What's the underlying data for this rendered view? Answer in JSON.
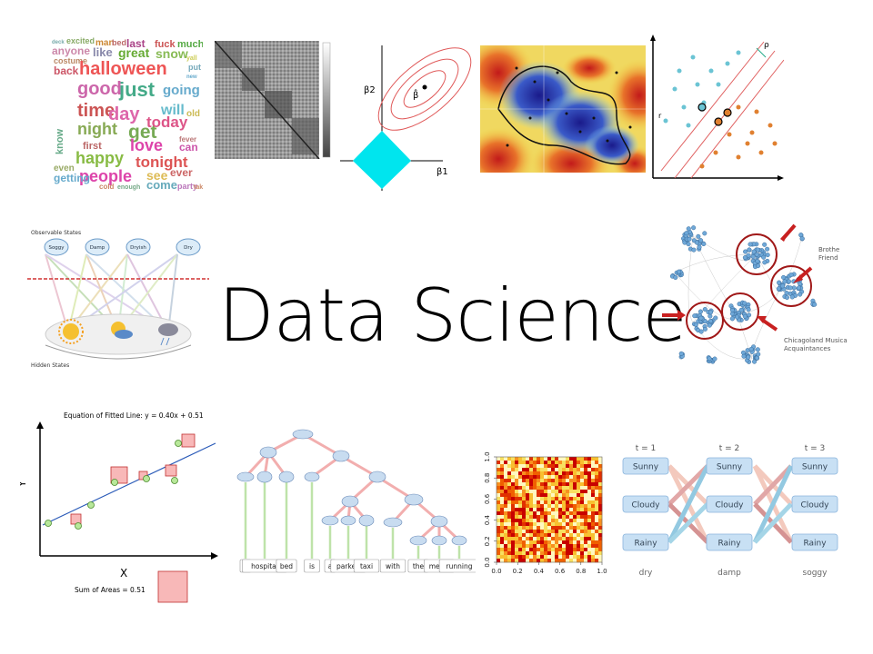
{
  "title": "Data Science",
  "wordcloud": {
    "words": [
      {
        "t": "deck",
        "c": "#7aa"
      },
      {
        "t": "excited",
        "c": "#8a6"
      },
      {
        "t": "man",
        "c": "#c83"
      },
      {
        "t": "bed",
        "c": "#b66"
      },
      {
        "t": "last",
        "c": "#a48"
      },
      {
        "t": "fuck",
        "c": "#c55"
      },
      {
        "t": "much",
        "c": "#5a4"
      },
      {
        "t": "anyone",
        "c": "#c8a"
      },
      {
        "t": "like",
        "c": "#88a"
      },
      {
        "t": "great",
        "c": "#6a3"
      },
      {
        "t": "snow",
        "c": "#8b5"
      },
      {
        "t": "yall",
        "c": "#cc5"
      },
      {
        "t": "costume",
        "c": "#b86"
      },
      {
        "t": "halloween",
        "c": "#e55"
      },
      {
        "t": "put",
        "c": "#7ab"
      },
      {
        "t": "back",
        "c": "#c56"
      },
      {
        "t": "new",
        "c": "#6ac"
      },
      {
        "t": "good",
        "c": "#c6a"
      },
      {
        "t": "just",
        "c": "#4a8"
      },
      {
        "t": "going",
        "c": "#6ac"
      },
      {
        "t": "time",
        "c": "#c55"
      },
      {
        "t": "day",
        "c": "#d6a"
      },
      {
        "t": "will",
        "c": "#6bc"
      },
      {
        "t": "old",
        "c": "#cb5"
      },
      {
        "t": "night",
        "c": "#8a5"
      },
      {
        "t": "get",
        "c": "#7a5"
      },
      {
        "t": "today",
        "c": "#d58"
      },
      {
        "t": "know",
        "c": "#6a8"
      },
      {
        "t": "first",
        "c": "#b66"
      },
      {
        "t": "love",
        "c": "#d4a"
      },
      {
        "t": "can",
        "c": "#c5a"
      },
      {
        "t": "fever",
        "c": "#b77"
      },
      {
        "t": "happy",
        "c": "#8b4"
      },
      {
        "t": "tonight",
        "c": "#d55"
      },
      {
        "t": "even",
        "c": "#9a6"
      },
      {
        "t": "people",
        "c": "#d4a"
      },
      {
        "t": "see",
        "c": "#db5"
      },
      {
        "t": "ever",
        "c": "#c66"
      },
      {
        "t": "getting",
        "c": "#6ac"
      },
      {
        "t": "come",
        "c": "#6ab"
      },
      {
        "t": "party",
        "c": "#b7b"
      },
      {
        "t": "cold",
        "c": "#c86"
      },
      {
        "t": "enough",
        "c": "#7a8"
      },
      {
        "t": "take",
        "c": "#c86"
      }
    ]
  },
  "lasso": {
    "beta1": "β1",
    "beta2": "β2",
    "betahat": "β̂"
  },
  "svm": {
    "rho": "ρ",
    "r": "r"
  },
  "hmm_top": {
    "observable_label": "Observable States",
    "hidden_label": "Hidden States",
    "states": [
      "Soggy",
      "Damp",
      "Dryish",
      "Dry"
    ]
  },
  "network": {
    "label1a": "Brothe",
    "label1b": "Friend",
    "label2a": "Chicagoland Musica",
    "label2b": "Acquaintances"
  },
  "regression": {
    "equation": "Equation of Fitted Line: y = 0.40x + 0.51",
    "xlabel": "X",
    "ylabel": "Y",
    "sum": "Sum of Areas = 0.51"
  },
  "parse_tree": {
    "words": [
      "a",
      "hospital",
      "bed",
      "is",
      "a",
      "parked",
      "taxi",
      "with",
      "the",
      "meter",
      "running"
    ]
  },
  "heatmap": {
    "ticks_x": [
      "0.0",
      "0.2",
      "0.4",
      "0.6",
      "0.8",
      "1.0"
    ],
    "ticks_y": [
      "0.0",
      "0.2",
      "0.4",
      "0.6",
      "0.8",
      "1.0"
    ]
  },
  "trellis": {
    "times": [
      "t = 1",
      "t = 2",
      "t = 3"
    ],
    "states": [
      "Sunny",
      "Cloudy",
      "Rainy"
    ],
    "obs": [
      "dry",
      "damp",
      "soggy"
    ]
  }
}
